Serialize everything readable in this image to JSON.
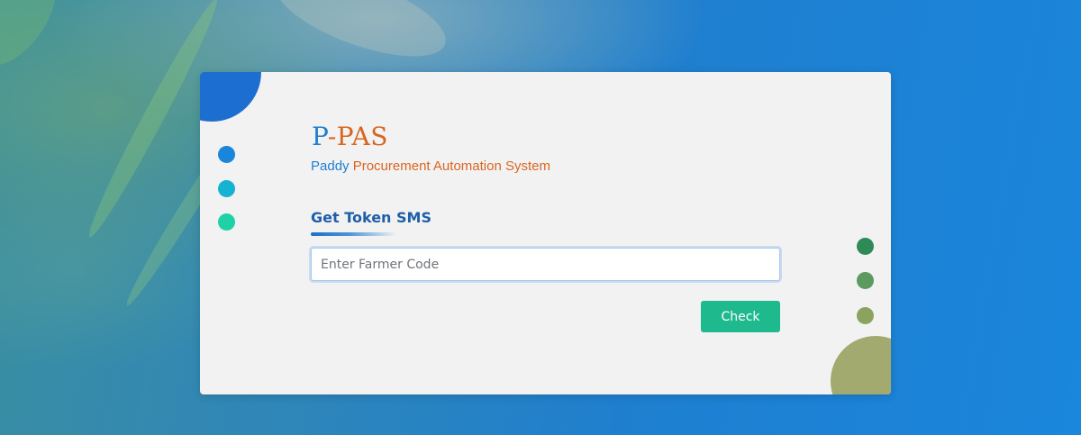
{
  "brand": {
    "title_first": "P",
    "title_rest": "-PAS",
    "subtitle_word1": "Paddy",
    "subtitle_rest": " Procurement Automation System"
  },
  "form": {
    "heading": "Get Token SMS",
    "farmer_code_value": "",
    "farmer_code_placeholder": "Enter Farmer Code",
    "check_label": "Check"
  },
  "colors": {
    "brand_blue": "#1e7fd0",
    "brand_orange": "#d9661f",
    "heading_blue": "#1f5fa8",
    "button_green": "#1fb98e",
    "card_bg": "#f2f2f3",
    "deco_left": [
      "#1a86db",
      "#15b3d1",
      "#1ed1a6"
    ],
    "deco_right": [
      "#2e8b57",
      "#5c9a5f",
      "#8aa460"
    ],
    "deco_big_top": "#1c6fd1",
    "deco_big_bottom": "#a3aa6f"
  }
}
